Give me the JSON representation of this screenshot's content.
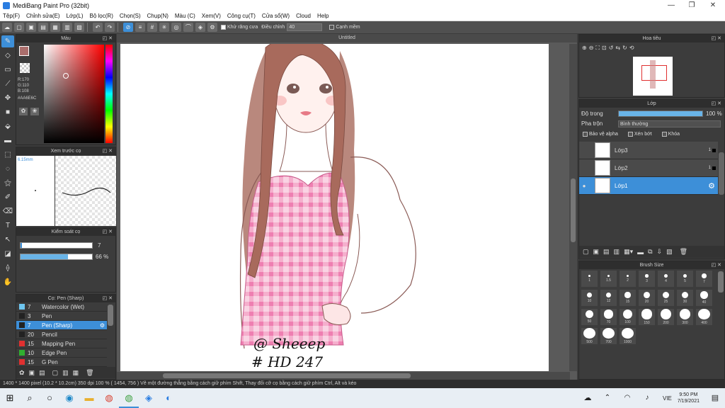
{
  "window": {
    "title": "MediBang Paint Pro (32bit)",
    "min": "—",
    "max": "❐",
    "close": "✕"
  },
  "menu": [
    "Tệp(F)",
    "Chỉnh sửa(E)",
    "Lớp(L)",
    "Bộ lọc(R)",
    "Chọn(S)",
    "Chụp(N)",
    "Màu (C)",
    "Xem(V)",
    "Công cụ(T)",
    "Cửa sổ(W)",
    "Cloud",
    "Help"
  ],
  "toolbar": {
    "antialias_label": "Khử răng cưa",
    "correction_label": "Điều chỉnh",
    "correction_value": "40",
    "snap_label": "Cạnh mềm"
  },
  "color_panel": {
    "title": "Màu",
    "r": "R:170",
    "g": "G:110",
    "b": "B:108",
    "hex": "#AA6E6C",
    "primary": "#AA6E6C"
  },
  "preview_panel": {
    "title": "Xem trước cọ",
    "size": "6.15mm"
  },
  "control_panel": {
    "title": "Kiểm soát cọ",
    "size_value": "7",
    "opacity_value": "66 %",
    "opacity": 0.66
  },
  "brush_panel": {
    "title": "Cọ: Pen (Sharp)",
    "brushes": [
      {
        "size": "7",
        "name": "Watercolor (Wet)",
        "color": "#6ec6f0"
      },
      {
        "size": "3",
        "name": "Pen",
        "color": "#222222"
      },
      {
        "size": "7",
        "name": "Pen (Sharp)",
        "color": "#222222"
      },
      {
        "size": "20",
        "name": "Pencil",
        "color": "#222222"
      },
      {
        "size": "15",
        "name": "Mapping Pen",
        "color": "#e03030"
      },
      {
        "size": "10",
        "name": "Edge Pen",
        "color": "#30b030"
      },
      {
        "size": "15",
        "name": "G Pen",
        "color": "#e03030"
      }
    ]
  },
  "canvas": {
    "title": "Untitled",
    "signature": "@ Sheeep",
    "tag": "# HD 247"
  },
  "navigator": {
    "title": "Hoa tiêu"
  },
  "layer_panel": {
    "title": "Lớp",
    "opacity_label": "Độ trong",
    "opacity_value": "100 %",
    "opacity": 1.0,
    "blend_label": "Pha trộn",
    "blend_value": "Bình thường",
    "protect_alpha": "Bảo vệ alpha",
    "clipping": "Xén bớt",
    "lock": "Khóa",
    "layers": [
      {
        "name": "Lớp3",
        "badge": "1"
      },
      {
        "name": "Lớp2",
        "badge": "1"
      },
      {
        "name": "Lớp1",
        "badge": ""
      }
    ]
  },
  "brush_size": {
    "title": "Brush Size",
    "sizes": [
      "1",
      "1.5",
      "2",
      "3",
      "4",
      "5",
      "7",
      "10",
      "12",
      "15",
      "20",
      "25",
      "30",
      "40",
      "50",
      "70",
      "100",
      "150",
      "200",
      "300",
      "400",
      "500",
      "700",
      "1000"
    ]
  },
  "status": {
    "text": "1400 * 1400 pixel   (10.2 * 10.2cm)   350 dpi   100 %   ( 1454, 756 )   Vẽ một đường thẳng bằng cách giữ phím Shift, Thay đổi cỡ cọ bằng cách giữ phím Ctrl, Alt và kéo"
  },
  "taskbar": {
    "lang": "VIE",
    "time": "9:50 PM",
    "date": "7/19/2021"
  }
}
